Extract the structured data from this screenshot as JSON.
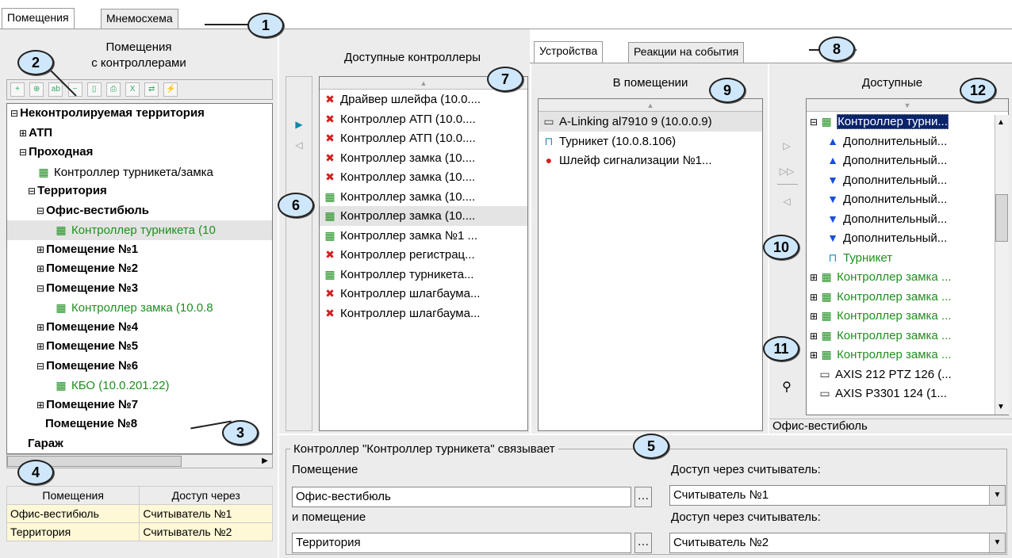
{
  "tabs_main": [
    "Помещения",
    "Мнемосхема"
  ],
  "rooms_panel": {
    "title": "Помещения\nс контроллерами",
    "tree": [
      {
        "label": "Неконтролируемая территория",
        "glyph": "⊟",
        "style": "bold",
        "indent": 0
      },
      {
        "label": "АТП",
        "glyph": "⊞",
        "style": "bold",
        "indent": 1
      },
      {
        "label": "Проходная",
        "glyph": "⊟",
        "style": "bold",
        "indent": 1
      },
      {
        "label": "Контроллер турникета/замка",
        "glyph": "",
        "style": "normal",
        "indent": 3,
        "icon": "controller"
      },
      {
        "label": "Территория",
        "glyph": "⊟",
        "style": "bold",
        "indent": 2
      },
      {
        "label": "Офис-вестибюль",
        "glyph": "⊟",
        "style": "bold",
        "indent": 3
      },
      {
        "label": "Контроллер турникета (10",
        "glyph": "",
        "style": "green-sel",
        "indent": 5,
        "icon": "controller"
      },
      {
        "label": "Помещение №1",
        "glyph": "⊞",
        "style": "bold",
        "indent": 3
      },
      {
        "label": "Помещение №2",
        "glyph": "⊞",
        "style": "bold",
        "indent": 3
      },
      {
        "label": "Помещение №3",
        "glyph": "⊟",
        "style": "bold",
        "indent": 3
      },
      {
        "label": "Контроллер замка (10.0.8",
        "glyph": "",
        "style": "green",
        "indent": 5,
        "icon": "controller"
      },
      {
        "label": "Помещение №4",
        "glyph": "⊞",
        "style": "bold",
        "indent": 3
      },
      {
        "label": "Помещение №5",
        "glyph": "⊞",
        "style": "bold",
        "indent": 3
      },
      {
        "label": "Помещение №6",
        "glyph": "⊟",
        "style": "bold",
        "indent": 3
      },
      {
        "label": "КБО (10.0.201.22)",
        "glyph": "",
        "style": "green",
        "indent": 5,
        "icon": "controller"
      },
      {
        "label": "Помещение №7",
        "glyph": "⊞",
        "style": "bold",
        "indent": 3
      },
      {
        "label": "Помещение №8",
        "glyph": "",
        "style": "bold",
        "indent": 4
      },
      {
        "label": "Гараж",
        "glyph": "",
        "style": "bold",
        "indent": 2
      }
    ],
    "grid_headers": [
      "Помещения",
      "Доступ через"
    ],
    "grid_rows": [
      [
        "Офис-вестибюль",
        "Считыватель №1"
      ],
      [
        "Территория",
        "Считыватель №2"
      ]
    ]
  },
  "controllers_panel": {
    "title": "Доступные контроллеры",
    "items": [
      {
        "label": "Драйвер шлейфа (10.0....",
        "icon": "x"
      },
      {
        "label": "Контроллер АТП (10.0....",
        "icon": "x"
      },
      {
        "label": "Контроллер АТП (10.0....",
        "icon": "x"
      },
      {
        "label": "Контроллер замка (10....",
        "icon": "x"
      },
      {
        "label": "Контроллер замка (10....",
        "icon": "x"
      },
      {
        "label": "Контроллер замка (10....",
        "icon": "controller"
      },
      {
        "label": "Контроллер замка (10....",
        "icon": "controller",
        "selected": true
      },
      {
        "label": "Контроллер замка №1 ...",
        "icon": "controller"
      },
      {
        "label": "Контроллер регистрац...",
        "icon": "x"
      },
      {
        "label": "Контроллер турникета...",
        "icon": "controller"
      },
      {
        "label": "Контроллер шлагбаума...",
        "icon": "x"
      },
      {
        "label": "Контроллер шлагбаума...",
        "icon": "x"
      }
    ]
  },
  "tabs_devices": [
    "Устройства",
    "Реакции на события"
  ],
  "in_room_panel": {
    "title": "В помещении",
    "items": [
      {
        "label": "A-Linking al7910 9 (10.0.0.9)",
        "icon": "camera",
        "selected": true
      },
      {
        "label": "Турникет (10.0.8.106)",
        "icon": "turnstile"
      },
      {
        "label": "Шлейф сигнализации №1...",
        "icon": "alarm"
      }
    ]
  },
  "available_panel": {
    "title": "Доступные",
    "footer": "Офис-вестибюль",
    "items": [
      {
        "label": "Контроллер турни...",
        "icon": "controller",
        "glyph": "⊟",
        "style": "hl",
        "indent": 0
      },
      {
        "label": "Дополнительный...",
        "icon": "up",
        "style": "normal",
        "indent": 2
      },
      {
        "label": "Дополнительный...",
        "icon": "up",
        "style": "normal",
        "indent": 2
      },
      {
        "label": "Дополнительный...",
        "icon": "down",
        "style": "normal",
        "indent": 2
      },
      {
        "label": "Дополнительный...",
        "icon": "down",
        "style": "normal",
        "indent": 2
      },
      {
        "label": "Дополнительный...",
        "icon": "down",
        "style": "normal",
        "indent": 2
      },
      {
        "label": "Дополнительный...",
        "icon": "down",
        "style": "normal",
        "indent": 2
      },
      {
        "label": "Турникет",
        "icon": "turnstile",
        "style": "green",
        "indent": 2
      },
      {
        "label": "Контроллер замка ...",
        "icon": "controller",
        "glyph": "⊞",
        "style": "green",
        "indent": 0
      },
      {
        "label": "Контроллер замка ...",
        "icon": "controller",
        "glyph": "⊞",
        "style": "green",
        "indent": 0
      },
      {
        "label": "Контроллер замка ...",
        "icon": "controller",
        "glyph": "⊞",
        "style": "green",
        "indent": 0
      },
      {
        "label": "Контроллер замка ...",
        "icon": "controller",
        "glyph": "⊞",
        "style": "green",
        "indent": 0
      },
      {
        "label": "Контроллер замка ...",
        "icon": "controller",
        "glyph": "⊞",
        "style": "green",
        "indent": 0
      },
      {
        "label": "AXIS 212 PTZ 126 (...",
        "icon": "camera",
        "style": "normal",
        "indent": 1
      },
      {
        "label": "AXIS P3301 124 (1...",
        "icon": "camera",
        "style": "normal",
        "indent": 1
      }
    ]
  },
  "link_box": {
    "legend": "Контроллер \"Контроллер турникета\" связывает",
    "room_label": "Помещение",
    "room1": "Офис-вестибюль",
    "and_room_label": "и помещение",
    "room2": "Территория",
    "reader_label1": "Доступ через считыватель:",
    "reader1": "Считыватель №1",
    "reader_label2": "Доступ через считыватель:",
    "reader2": "Считыватель №2"
  },
  "callouts": [
    "1",
    "2",
    "3",
    "4",
    "5",
    "6",
    "7",
    "8",
    "9",
    "10",
    "11",
    "12"
  ],
  "icons": {
    "x": "✖",
    "controller": "▦",
    "camera": "▭",
    "turnstile": "⊓",
    "alarm": "●",
    "up": "▲",
    "down": "▼",
    "binoculars": "⚲"
  },
  "colors": {
    "green": "#1f8f1f",
    "red": "#d42020",
    "blue": "#1a4fd6",
    "callout_fill": "#cfe7fa",
    "highlight": "#0a246a"
  }
}
